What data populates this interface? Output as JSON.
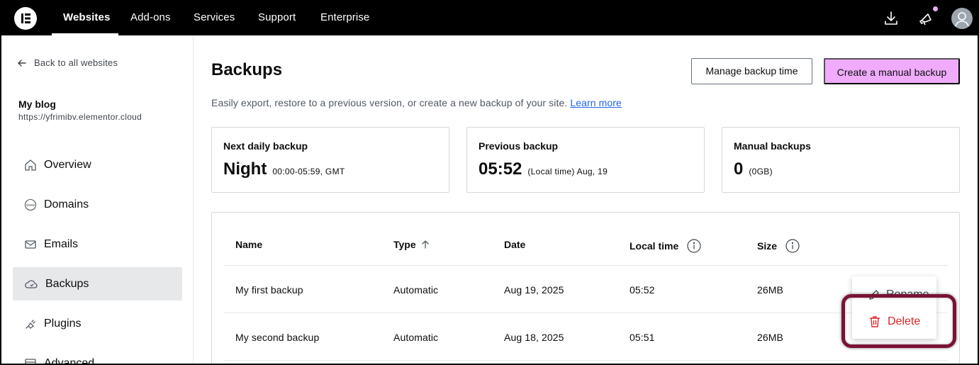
{
  "topnav": {
    "items": [
      {
        "label": "Websites",
        "active": true
      },
      {
        "label": "Add-ons",
        "active": false
      },
      {
        "label": "Services",
        "active": false
      },
      {
        "label": "Support",
        "active": false
      },
      {
        "label": "Enterprise",
        "active": false
      }
    ],
    "icons": [
      "download-icon",
      "megaphone-icon",
      "avatar-icon"
    ],
    "notification_color": "#f0abfc"
  },
  "sidebar": {
    "back_label": "Back to all websites",
    "site_name": "My blog",
    "site_url": "https://yfrimibv.elementor.cloud",
    "items": [
      {
        "label": "Overview",
        "icon": "home-icon",
        "active": false
      },
      {
        "label": "Domains",
        "icon": "www-globe-icon",
        "active": false
      },
      {
        "label": "Emails",
        "icon": "mail-icon",
        "active": false
      },
      {
        "label": "Backups",
        "icon": "cloud-icon",
        "active": true
      },
      {
        "label": "Plugins",
        "icon": "plug-icon",
        "active": false
      },
      {
        "label": "Advanced",
        "icon": "advanced-icon",
        "active": false
      }
    ]
  },
  "main": {
    "title": "Backups",
    "manage_button": "Manage backup time",
    "create_button": "Create a manual backup",
    "description": "Easily export, restore to a previous version, or create a new backup of your site.",
    "learn_more": "Learn more",
    "cards": [
      {
        "label": "Next daily backup",
        "value": "Night",
        "sub": "00:00-05:59, GMT"
      },
      {
        "label": "Previous backup",
        "value": "05:52",
        "sub": "(Local time) Aug, 19"
      },
      {
        "label": "Manual backups",
        "value": "0",
        "sub": "(0GB)"
      }
    ],
    "table": {
      "headers": [
        "Name",
        "Type",
        "Date",
        "Local time",
        "Size"
      ],
      "rows": [
        {
          "name": "My first backup",
          "type": "Automatic",
          "date": "Aug 19, 2025",
          "time": "05:52",
          "size": "26MB"
        },
        {
          "name": "My second backup",
          "type": "Automatic",
          "date": "Aug 18, 2025",
          "time": "05:51",
          "size": "26MB"
        }
      ]
    },
    "menu": {
      "rename": "Rename",
      "delete": "Delete"
    }
  },
  "colors": {
    "accent": "#f0abfc",
    "danger": "#dc2626",
    "highlight": "#7a1236"
  }
}
